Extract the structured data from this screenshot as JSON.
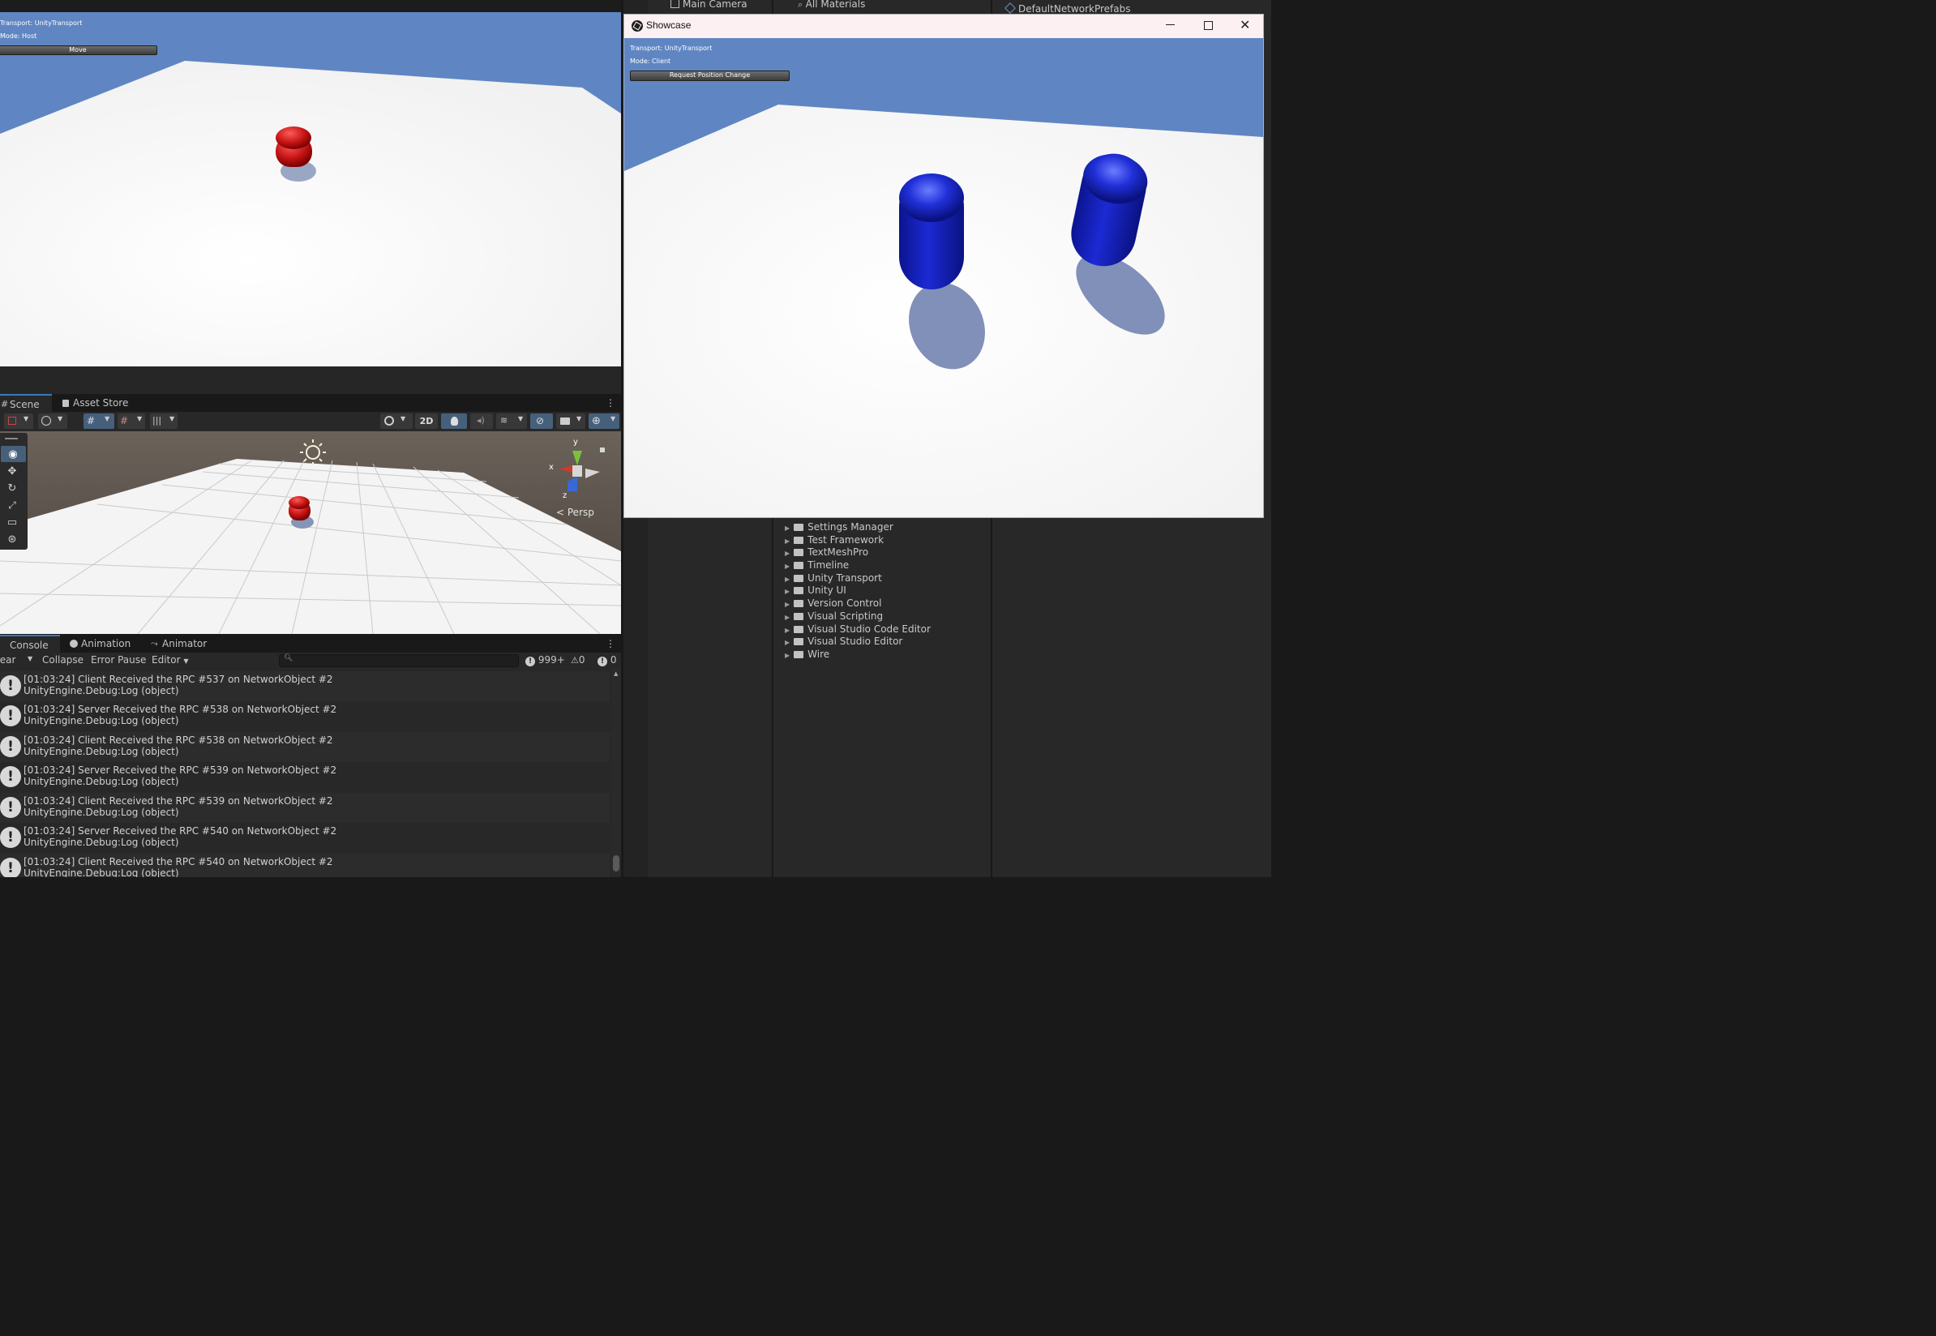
{
  "host_view": {
    "transport": "Transport: UnityTransport",
    "mode": "Mode: Host",
    "button": "Move"
  },
  "scene_tabs": [
    {
      "label": "Scene"
    },
    {
      "label": "Asset Store"
    }
  ],
  "scene_toolbar": {
    "twod_label": "2D",
    "persp_label": "Persp"
  },
  "gizmo": {
    "y": "y",
    "x": "x",
    "z": "z"
  },
  "console_tabs": [
    {
      "label": "Console"
    },
    {
      "label": "Animation"
    },
    {
      "label": "Animator"
    }
  ],
  "console_toolbar": {
    "clear": "Clear",
    "collapse": "Collapse",
    "error_pause": "Error Pause",
    "editor": "Editor",
    "log_count": "999+",
    "warn_count": "0",
    "error_count": "0"
  },
  "console_logs": [
    {
      "line1": "[01:03:24] Client Received the RPC #537 on NetworkObject #2",
      "line2": "UnityEngine.Debug:Log (object)"
    },
    {
      "line1": "[01:03:24] Server Received the RPC #538 on NetworkObject #2",
      "line2": "UnityEngine.Debug:Log (object)"
    },
    {
      "line1": "[01:03:24] Client Received the RPC #538 on NetworkObject #2",
      "line2": "UnityEngine.Debug:Log (object)"
    },
    {
      "line1": "[01:03:24] Server Received the RPC #539 on NetworkObject #2",
      "line2": "UnityEngine.Debug:Log (object)"
    },
    {
      "line1": "[01:03:24] Client Received the RPC #539 on NetworkObject #2",
      "line2": "UnityEngine.Debug:Log (object)"
    },
    {
      "line1": "[01:03:24] Server Received the RPC #540 on NetworkObject #2",
      "line2": "UnityEngine.Debug:Log (object)"
    },
    {
      "line1": "[01:03:24] Client Received the RPC #540 on NetworkObject #2",
      "line2": "UnityEngine.Debug:Log (object)"
    }
  ],
  "hierarchy_top": "Main Camera",
  "project_search_top": "All Materials",
  "inspector_top": "DefaultNetworkPrefabs",
  "packages": [
    "Settings Manager",
    "Test Framework",
    "TextMeshPro",
    "Timeline",
    "Unity Transport",
    "Unity UI",
    "Version Control",
    "Visual Scripting",
    "Visual Studio Code Editor",
    "Visual Studio Editor",
    "Wire"
  ],
  "showcase": {
    "title": "Showcase",
    "transport": "Transport: UnityTransport",
    "mode": "Mode: Client",
    "button": "Request Position Change"
  },
  "colors": {
    "accent": "#3a79bb",
    "sky": "#5f86c2",
    "host_player": "#cc1a1a",
    "client_player": "#1a24c0"
  }
}
